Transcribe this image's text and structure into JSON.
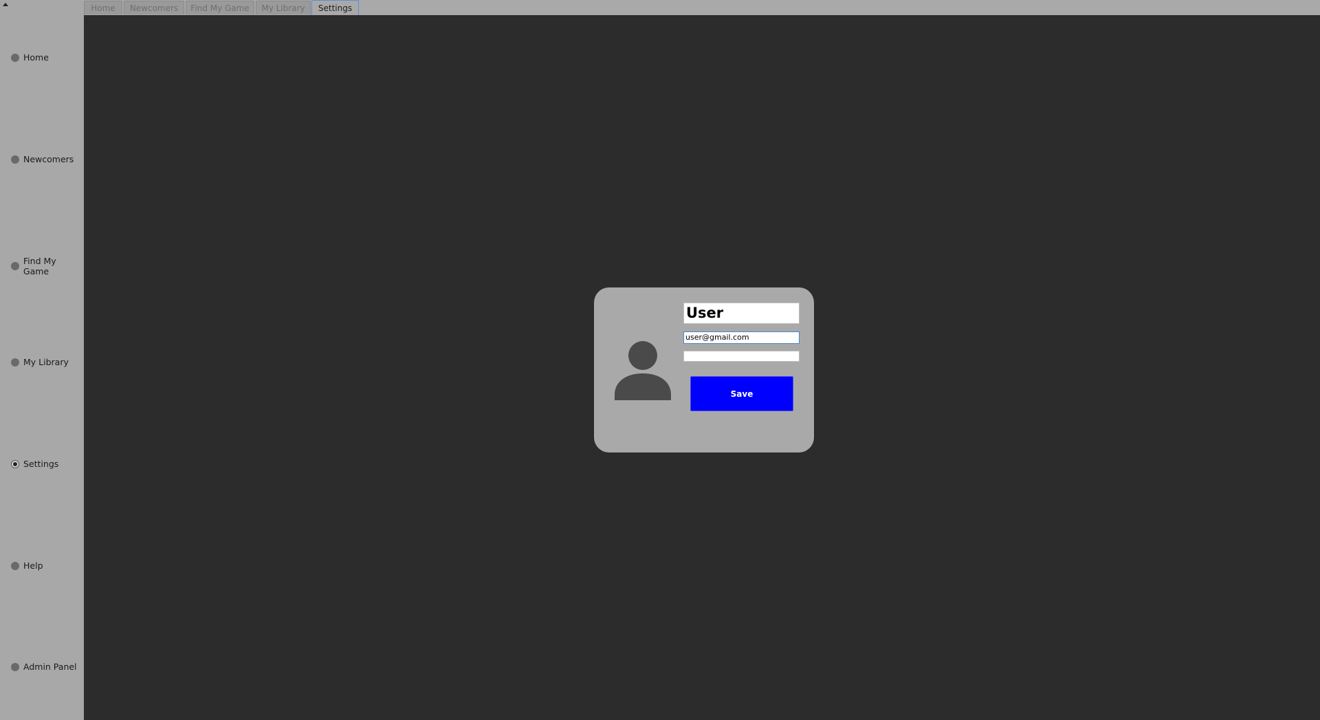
{
  "sidebar": {
    "items": [
      {
        "label": "Home",
        "checked": false
      },
      {
        "label": "Newcomers",
        "checked": false
      },
      {
        "label": "Find My Game",
        "checked": false
      },
      {
        "label": "My Library",
        "checked": false
      },
      {
        "label": "Settings",
        "checked": true
      },
      {
        "label": "Help",
        "checked": false
      },
      {
        "label": "Admin Panel",
        "checked": false
      }
    ]
  },
  "tabs": [
    {
      "label": "Home",
      "active": false
    },
    {
      "label": "Newcomers",
      "active": false
    },
    {
      "label": "Find My Game",
      "active": false
    },
    {
      "label": "My Library",
      "active": false
    },
    {
      "label": "Settings",
      "active": true
    }
  ],
  "profile": {
    "name_value": "User",
    "email_value": "user@gmail.com",
    "password_value": "",
    "save_label": "Save",
    "avatar_icon": "user-avatar-icon"
  },
  "colors": {
    "accent": "#0000ff",
    "main_background": "#2c2c2c",
    "panel_background": "#a9a9a9",
    "focus_border": "#4a86c8"
  }
}
